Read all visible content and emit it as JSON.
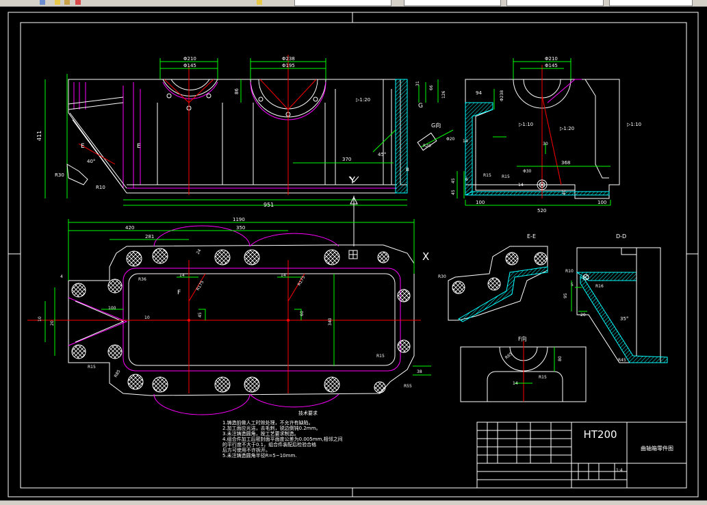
{
  "colors": {
    "background": "#000000",
    "outline": "#ffffff",
    "dimension": "#00ff00",
    "center": "#ff0000",
    "section": "#ff00ff",
    "hatch": "#00ffff",
    "yellow": "#ffff00"
  },
  "drawing": {
    "view_labels": {
      "section_ee": "E-E",
      "section_dd": "D-D",
      "view_f": "F向",
      "view_g": "G向",
      "axis_x": "X",
      "axis_y": "Y",
      "cut_e_left": "E",
      "cut_e_right": "E",
      "cut_f": "F",
      "cut_g": "G",
      "cut_b": "B",
      "cut_a": "A",
      "cut_d": "D"
    },
    "dimensions": {
      "top_overall_length": "951",
      "top_height": "411",
      "top_bore_1_outer": "Φ210",
      "top_bore_1_inner": "Φ145",
      "top_bore_2_outer": "Φ238",
      "top_bore_2_inner": "Φ195",
      "top_86": "86",
      "top_370": "370",
      "top_45deg": "45°",
      "top_taper": "▷1:20",
      "top_r30": "R30",
      "top_r10": "R10",
      "top_40deg": "40°",
      "side_bore_outer": "Φ210",
      "side_bore_inner": "Φ145",
      "side_94": "94",
      "side_238": "Φ238",
      "side_31": "31",
      "side_66": "66",
      "side_126": "126",
      "side_taper_1": "▷1:10",
      "side_taper_2": "▷1:20",
      "side_taper_3": "▷1:10",
      "side_14": "14",
      "side_30": "30",
      "side_368": "368",
      "side_r15a": "R15",
      "side_r15b": "R15",
      "side_phi30": "Φ30",
      "side_45a": "45",
      "side_45b": "45",
      "side_6": "6",
      "side_14b": "14",
      "side_40": "40",
      "side_100a": "100",
      "side_100b": "100",
      "side_520": "520",
      "g_r20": "R20",
      "g_phi": "Φ20",
      "plan_1190": "1190",
      "plan_420": "420",
      "plan_350": "350",
      "plan_281": "281",
      "plan_4": "4",
      "plan_r36": "R36",
      "plan_14": "14",
      "plan_14b": "14",
      "plan_24": "24",
      "plan_r175": "R175",
      "plan_r175b": "R175",
      "plan_45": "45",
      "plan_60": "60",
      "plan_340": "340",
      "plan_r15": "R15",
      "plan_38": "38",
      "plan_r55": "R55",
      "plan_r15b": "R15",
      "plan_r85": "R85",
      "plan_100": "100",
      "plan_20": "20",
      "plan_10": "10",
      "plan_10b": "10",
      "ee_r30": "R30",
      "dd_r10": "R10",
      "dd_r16": "R16",
      "dd_5": "5",
      "dd_95": "95",
      "dd_20": "20",
      "dd_35deg": "35°",
      "dd_r45": "R45",
      "f_r65": "R65",
      "f_80": "80",
      "f_r15": "R15",
      "f_14": "14"
    }
  },
  "notes": {
    "title": "技术要求",
    "lines": [
      "1.铸造前做人工时效处理，不允许有缺陷。",
      "2.加工面应光洁，去毛刺，锐边倒钝0.2mm。",
      "3.未注铸造圆角，按工艺要求制造。",
      "4.组合件加工后密封面平面度公差为0.005mm,相邻之间",
      "  的平行度不大于0.1，组合件装配后检验合格",
      "  后方可使用不许拆开。",
      "5.未注铸造圆角半径R=5~10mm."
    ]
  },
  "title_block": {
    "material": "HT200",
    "drawing_name": "曲轴箱零件图",
    "scale": "1:4"
  }
}
